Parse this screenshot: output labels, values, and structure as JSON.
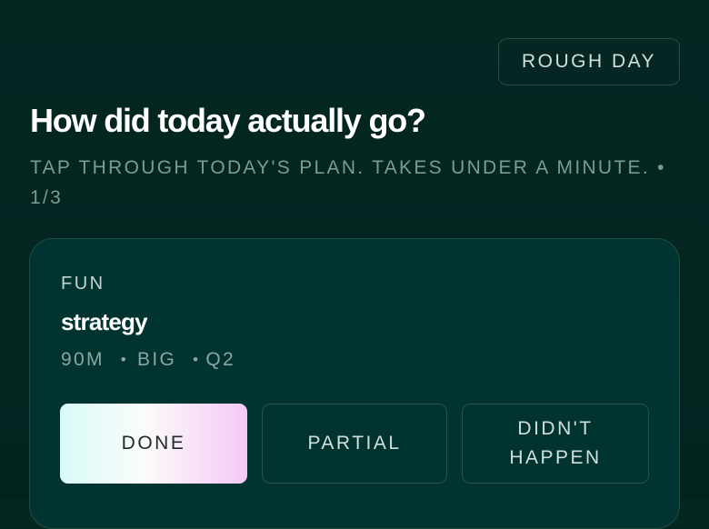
{
  "header": {
    "rough_day_label": "ROUGH DAY",
    "title": "How did today actually go?",
    "subtitle": "TAP THROUGH TODAY'S PLAN. TAKES UNDER A MINUTE. • 1/3"
  },
  "card": {
    "category": "FUN",
    "task_name": "strategy",
    "meta": {
      "duration": "90M",
      "size": "BIG",
      "quarter": "Q2"
    },
    "actions": {
      "done": "DONE",
      "partial": "PARTIAL",
      "didnt_happen": "DIDN'T HAPPEN"
    }
  },
  "colors": {
    "background": "#052722",
    "card_background": "#013430",
    "done_gradient_start": "#d8fbf7",
    "done_gradient_end": "#f3c9f6"
  }
}
